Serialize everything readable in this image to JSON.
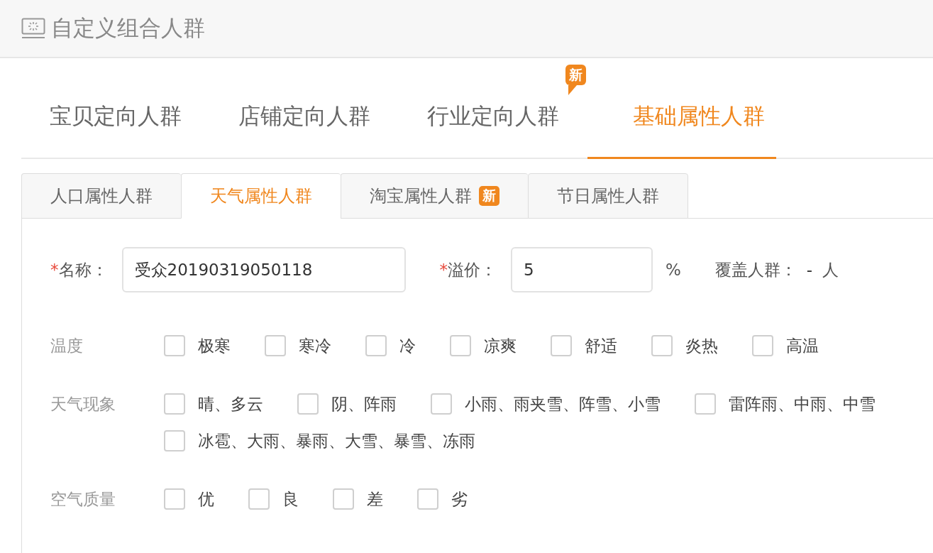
{
  "header": {
    "title": "自定义组合人群"
  },
  "main_tabs": [
    {
      "label": "宝贝定向人群",
      "selected": false
    },
    {
      "label": "店铺定向人群",
      "selected": false
    },
    {
      "label": "行业定向人群",
      "selected": false,
      "badge": "新"
    },
    {
      "label": "基础属性人群",
      "selected": true
    }
  ],
  "sub_tabs": [
    {
      "label": "人口属性人群",
      "selected": false
    },
    {
      "label": "天气属性人群",
      "selected": true
    },
    {
      "label": "淘宝属性人群",
      "selected": false,
      "badge": "新"
    },
    {
      "label": "节日属性人群",
      "selected": false
    }
  ],
  "form": {
    "name": {
      "marker": "*",
      "label": "名称：",
      "value": "受众20190319050118"
    },
    "premium": {
      "marker": "*",
      "label": "溢价：",
      "value": "5",
      "unit": "%"
    },
    "coverage": {
      "label": "覆盖人群：",
      "value": "-",
      "unit": "人"
    }
  },
  "groups": [
    {
      "label": "温度",
      "options": [
        {
          "label": "极寒",
          "checked": false
        },
        {
          "label": "寒冷",
          "checked": false
        },
        {
          "label": "冷",
          "checked": false
        },
        {
          "label": "凉爽",
          "checked": false
        },
        {
          "label": "舒适",
          "checked": false
        },
        {
          "label": "炎热",
          "checked": false
        },
        {
          "label": "高温",
          "checked": false
        }
      ]
    },
    {
      "label": "天气现象",
      "options": [
        {
          "label": "晴、多云",
          "checked": false
        },
        {
          "label": "阴、阵雨",
          "checked": false
        },
        {
          "label": "小雨、雨夹雪、阵雪、小雪",
          "checked": false
        },
        {
          "label": "雷阵雨、中雨、中雪",
          "checked": false
        },
        {
          "label": "冰雹、大雨、暴雨、大雪、暴雪、冻雨",
          "checked": false
        }
      ]
    },
    {
      "label": "空气质量",
      "options": [
        {
          "label": "优",
          "checked": false
        },
        {
          "label": "良",
          "checked": false
        },
        {
          "label": "差",
          "checked": false
        },
        {
          "label": "劣",
          "checked": false
        }
      ]
    }
  ]
}
